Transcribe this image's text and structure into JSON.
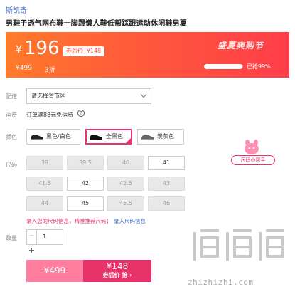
{
  "product": {
    "brand": "斯凯奇",
    "title": "男鞋子透气网布鞋一脚蹬懒人鞋低帮踩跟运动休闲鞋男夏"
  },
  "price_banner": {
    "currency": "¥",
    "price": "196",
    "coupon_label": "券后价",
    "coupon_price": "¥148",
    "original_price": "¥499",
    "discount": "3折",
    "event_name": "盛夏爽购节",
    "sold_progress": 0.99,
    "sold_text": "已抢99%",
    "colors": {
      "start": "#ff7a2a",
      "end": "#ff3d4a"
    }
  },
  "shipping": {
    "label": "配送",
    "selected": "请选择省市区"
  },
  "freight": {
    "label": "运费",
    "text": "订单满88元免运费",
    "help_icon": "?"
  },
  "color": {
    "label": "颜色",
    "options": [
      {
        "label": "黑色/白色",
        "selected": false
      },
      {
        "label": "全黑色",
        "selected": true
      },
      {
        "label": "炭灰色",
        "selected": false
      }
    ]
  },
  "size": {
    "label": "尺码",
    "rows": [
      [
        {
          "value": "39",
          "available": false
        },
        {
          "value": "39.5",
          "available": false
        },
        {
          "value": "40",
          "available": false
        },
        {
          "value": "41",
          "available": true
        }
      ],
      [
        {
          "value": "41.5",
          "available": false
        },
        {
          "value": "42",
          "available": true
        },
        {
          "value": "42.5",
          "available": false
        },
        {
          "value": "43",
          "available": false
        }
      ],
      [
        {
          "value": "44",
          "available": false
        },
        {
          "value": "45",
          "available": true
        },
        {
          "value": "45.5",
          "available": false
        },
        {
          "value": "46",
          "available": false
        }
      ]
    ],
    "tip": "录入您的尺码信息，精准推荐尺码；",
    "tip_link": "录入尺码信息",
    "helper_label": "尺码小帮手"
  },
  "quantity": {
    "label": "数量",
    "value": "1",
    "minus": "−",
    "plus": "+"
  },
  "actions": {
    "buy_price": "¥499",
    "coupon_price": "¥148",
    "coupon_label": "券后价 抢 ›"
  },
  "watermark": {
    "text": "zhizhizhi.com",
    "accent": "#e8336a"
  }
}
